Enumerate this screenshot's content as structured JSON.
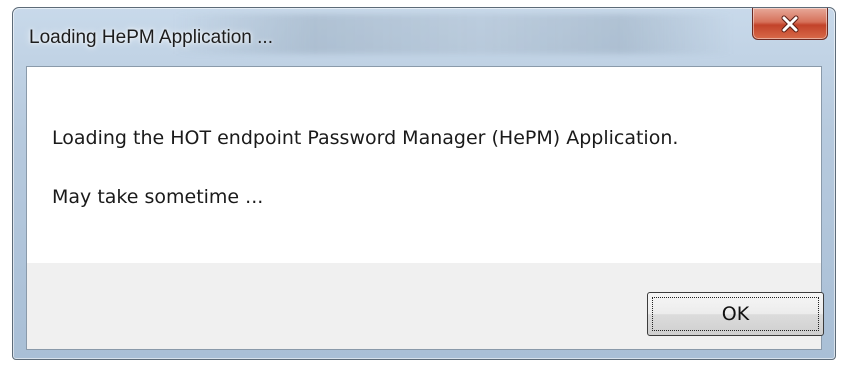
{
  "window": {
    "title": "Loading HePM Application ..."
  },
  "titlebar": {
    "close_icon": "close-x-icon"
  },
  "message": {
    "line1": "Loading the HOT endpoint Password Manager (HePM) Application.",
    "line2": "May take sometime ..."
  },
  "buttons": {
    "ok_label": "OK"
  },
  "colors": {
    "close_button": "#c94a30",
    "frame": "#b7cade",
    "content_bg": "#ffffff",
    "footer_bg": "#f0f0f0"
  }
}
